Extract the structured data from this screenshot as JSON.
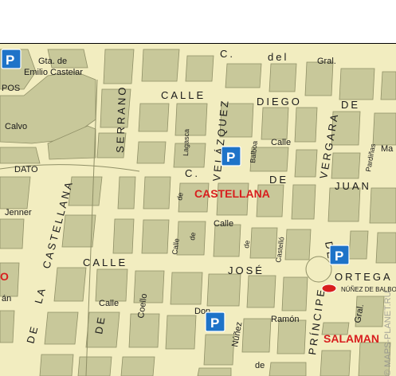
{
  "colors": {
    "street": "#f2edc0",
    "block": "#c8c89a",
    "block_edge": "#8f8f66",
    "district": "#d81e1e",
    "parking": "#1e73c8",
    "metro": "#d81e1e"
  },
  "labels": {
    "gta_1": "Gta. de",
    "gta_2": "Emilio Castelar",
    "pos": "POS",
    "calvo": "Calvo",
    "dato": "DATO",
    "jenner": "Jenner",
    "castellana_ave": "CASTELLANA",
    "la": "LA",
    "de_ave": "DE",
    "calle_lower": "CALLE",
    "de_lower": "DE",
    "serrano": "SERRANO",
    "calle_top": "CALLE",
    "diego": "DIEGO",
    "de_top": "DE",
    "c_top": "C.",
    "del_top": "del",
    "gral_top": "Gral.",
    "ma": "Ma",
    "lagasca": "Lagasca",
    "velazquez": "VELÁZQUEZ",
    "balboa": "Balboa",
    "calle_small_1": "Calle",
    "vergara": "VERGARA",
    "pardinas": "Pardiñas",
    "c_mid": "C.",
    "de_mid": "DE",
    "juan": "JUAN",
    "de_vert": "de",
    "district": "CASTELLANA",
    "calle_small_2": "Calle",
    "calle_small_3": "Calle",
    "calle_small_4": "Calle",
    "de_small_1": "de",
    "de_small_2": "de",
    "de_small_3": "de",
    "castello": "Castelló",
    "jose": "JOSÉ",
    "de_right": "DE",
    "ortega": "ORTEGA",
    "principe": "PRÍNCIPE",
    "coello": "Coello",
    "don": "Don",
    "ramon": "Ramón",
    "nunez": "Núñez",
    "de_bottom": "de",
    "gral_right": "Gral.",
    "metro_station": "NÚÑEZ DE BALBOA",
    "salaman": "SALAMAN",
    "red_left": "O",
    "an_left": "án",
    "watermark": "© MAPS-PLANET.RU"
  }
}
